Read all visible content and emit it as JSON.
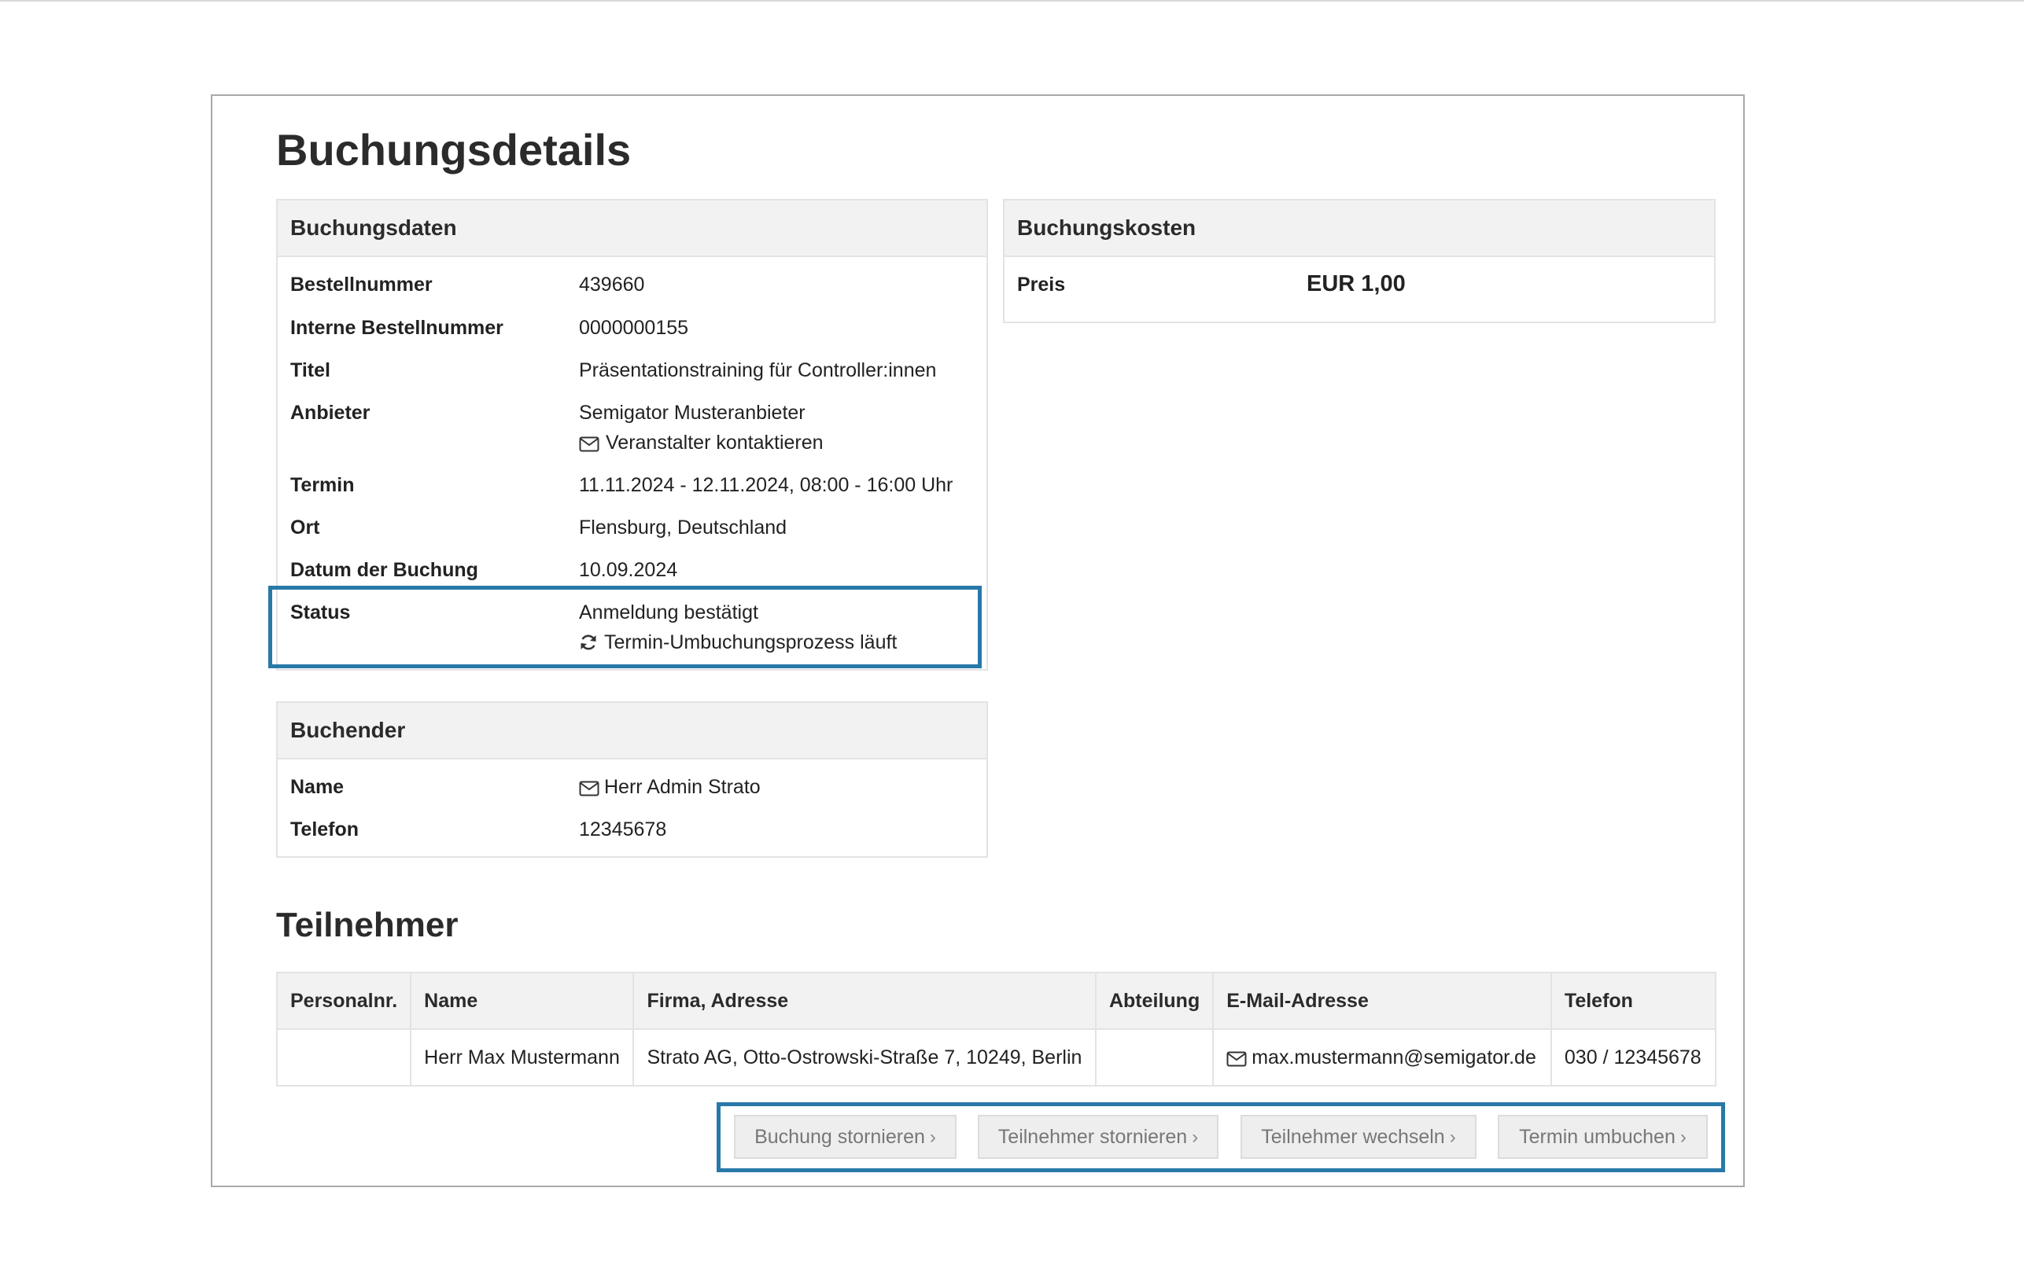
{
  "page": {
    "title": "Buchungsdetails"
  },
  "buchungsdaten": {
    "heading": "Buchungsdaten",
    "rows": [
      {
        "label": "Bestellnummer",
        "value": "439660"
      },
      {
        "label": "Interne Bestellnummer",
        "value": "0000000155"
      },
      {
        "label": "Titel",
        "value": "Präsentationstraining für Controller:innen"
      },
      {
        "label": "Anbieter",
        "value": "Semigator Musteranbieter",
        "link": "Veranstalter kontaktieren"
      },
      {
        "label": "Termin",
        "value": "11.11.2024 - 12.11.2024, 08:00 - 16:00 Uhr"
      },
      {
        "label": "Ort",
        "value": "Flensburg, Deutschland"
      },
      {
        "label": "Datum der Buchung",
        "value": "10.09.2024"
      },
      {
        "label": "Status",
        "value": "Anmeldung bestätigt",
        "sub": "Termin-Umbuchungsprozess läuft"
      }
    ]
  },
  "buchungskosten": {
    "heading": "Buchungskosten",
    "price_label": "Preis",
    "price_value": "EUR 1,00"
  },
  "buchender": {
    "heading": "Buchender",
    "name_label": "Name",
    "name_value": "Herr Admin Strato",
    "phone_label": "Telefon",
    "phone_value": "12345678"
  },
  "teilnehmer": {
    "heading": "Teilnehmer",
    "columns": [
      "Personalnr.",
      "Name",
      "Firma, Adresse",
      "Abteilung",
      "E-Mail-Adresse",
      "Telefon"
    ],
    "rows": [
      {
        "personalnr": "",
        "name": "Herr Max Mustermann",
        "firma": "Strato AG, Otto-Ostrowski-Straße 7, 10249, Berlin",
        "abteilung": "",
        "email": "max.mustermann@semigator.de",
        "telefon": "030 / 12345678"
      }
    ]
  },
  "actions": {
    "buchung_stornieren": "Buchung stornieren",
    "teilnehmer_stornieren": "Teilnehmer stornieren",
    "teilnehmer_wechseln": "Teilnehmer wechseln",
    "termin_umbuchen": "Termin umbuchen"
  },
  "icons": {
    "mail": "envelope-icon",
    "status": "refresh-icon",
    "button_arrow": "chevron-right-icon"
  },
  "colors": {
    "highlight": "#2878a8",
    "panel_header": "#f2f2f2",
    "button_bg": "#eeeeee"
  }
}
